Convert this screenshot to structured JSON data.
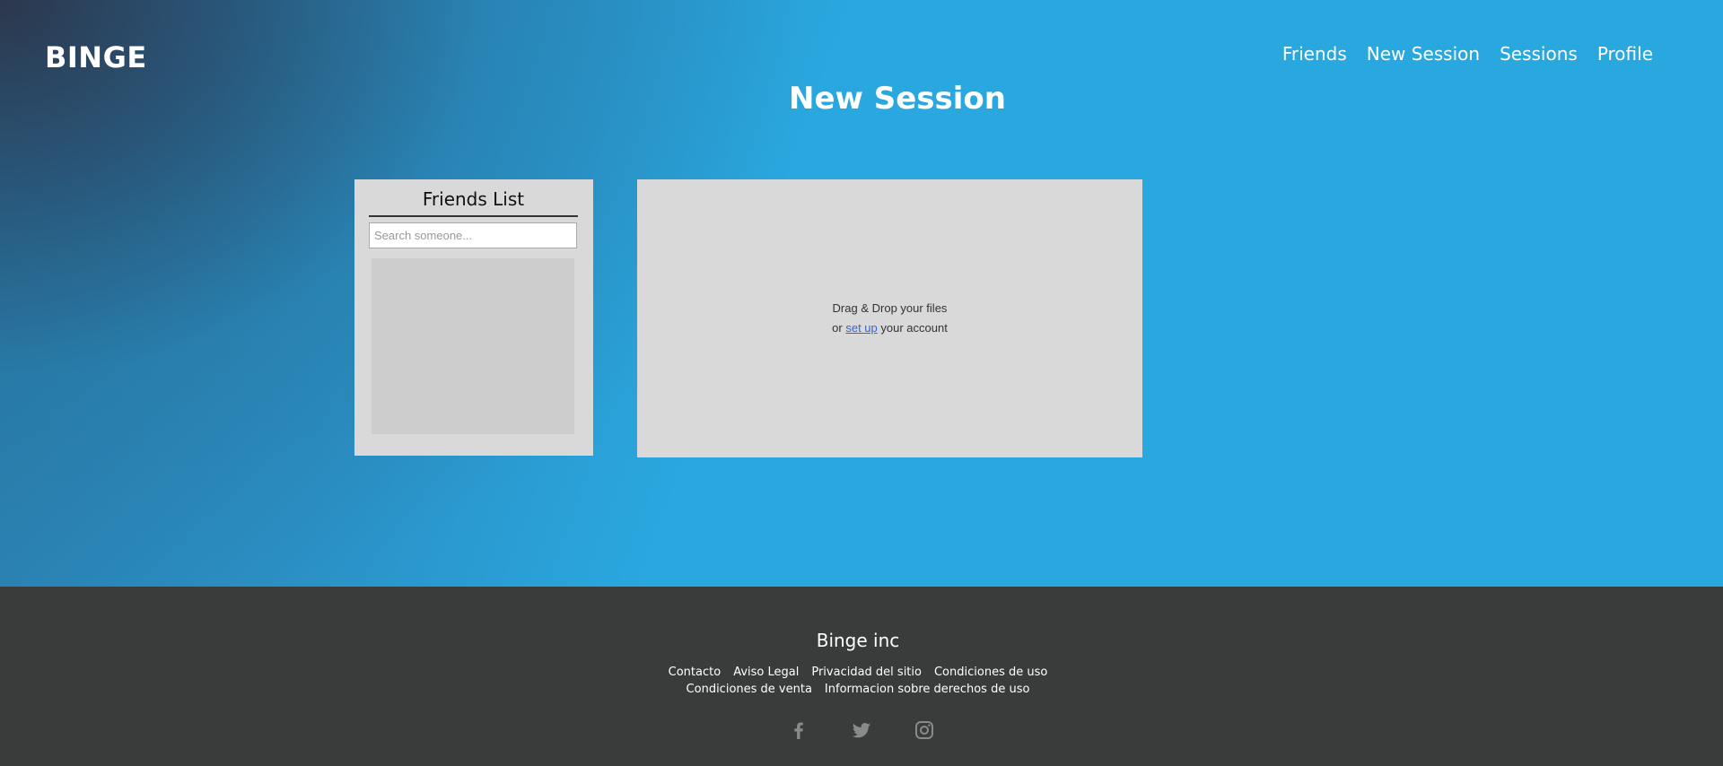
{
  "header": {
    "logo": "BINGE",
    "nav": [
      "Friends",
      "New Session",
      "Sessions",
      "Profile"
    ]
  },
  "main": {
    "title": "New Session",
    "friends_panel": {
      "title": "Friends List",
      "search_placeholder": "Search someone..."
    },
    "drop_zone": {
      "line1": "Drag & Drop your files",
      "line2_prefix": "or ",
      "line2_link": "set up",
      "line2_suffix": " your account"
    }
  },
  "footer": {
    "brand": "Binge inc",
    "links_row1": [
      "Contacto",
      "Aviso Legal",
      "Privacidad del sitio",
      "Condiciones de uso"
    ],
    "links_row2": [
      "Condiciones de venta",
      "Informacion sobre derechos de uso"
    ],
    "social": [
      "facebook-icon",
      "twitter-icon",
      "instagram-icon"
    ]
  },
  "colors": {
    "accent": "#29a8e0",
    "footer_bg": "#3a3b3b",
    "panel_bg": "#d9d9d9",
    "link": "#3366cc"
  }
}
